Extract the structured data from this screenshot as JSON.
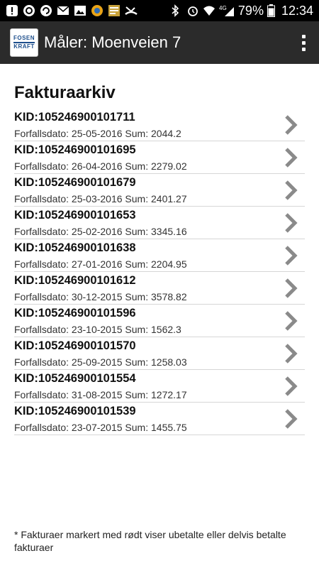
{
  "statusbar": {
    "battery": "79%",
    "clock": "12:34",
    "network": "4G"
  },
  "appbar": {
    "logo_text_top": "FOSEN",
    "logo_text_bottom": "KRAFT",
    "title": "Måler: Moenveien 7",
    "overflow_icon": "more-vert-icon"
  },
  "page": {
    "title": "Fakturaarkiv"
  },
  "invoices": [
    {
      "kid": "KID:105246900101711",
      "detail": "Forfallsdato: 25-05-2016 Sum: 2044.2"
    },
    {
      "kid": "KID:105246900101695",
      "detail": "Forfallsdato: 26-04-2016 Sum: 2279.02"
    },
    {
      "kid": "KID:105246900101679",
      "detail": "Forfallsdato: 25-03-2016 Sum: 2401.27"
    },
    {
      "kid": "KID:105246900101653",
      "detail": "Forfallsdato: 25-02-2016 Sum: 3345.16"
    },
    {
      "kid": "KID:105246900101638",
      "detail": "Forfallsdato: 27-01-2016 Sum: 2204.95"
    },
    {
      "kid": "KID:105246900101612",
      "detail": "Forfallsdato: 30-12-2015 Sum: 3578.82"
    },
    {
      "kid": "KID:105246900101596",
      "detail": "Forfallsdato: 23-10-2015 Sum: 1562.3"
    },
    {
      "kid": "KID:105246900101570",
      "detail": "Forfallsdato: 25-09-2015 Sum: 1258.03"
    },
    {
      "kid": "KID:105246900101554",
      "detail": "Forfallsdato: 31-08-2015 Sum: 1272.17"
    },
    {
      "kid": "KID:105246900101539",
      "detail": "Forfallsdato: 23-07-2015 Sum: 1455.75"
    }
  ],
  "footer": {
    "note": "* Fakturaer markert med rødt viser ubetalte eller delvis betalte fakturaer"
  },
  "colors": {
    "appbar": "#2b2b2b",
    "chevron": "#8a8a8a",
    "divider": "#d6d6d6"
  }
}
